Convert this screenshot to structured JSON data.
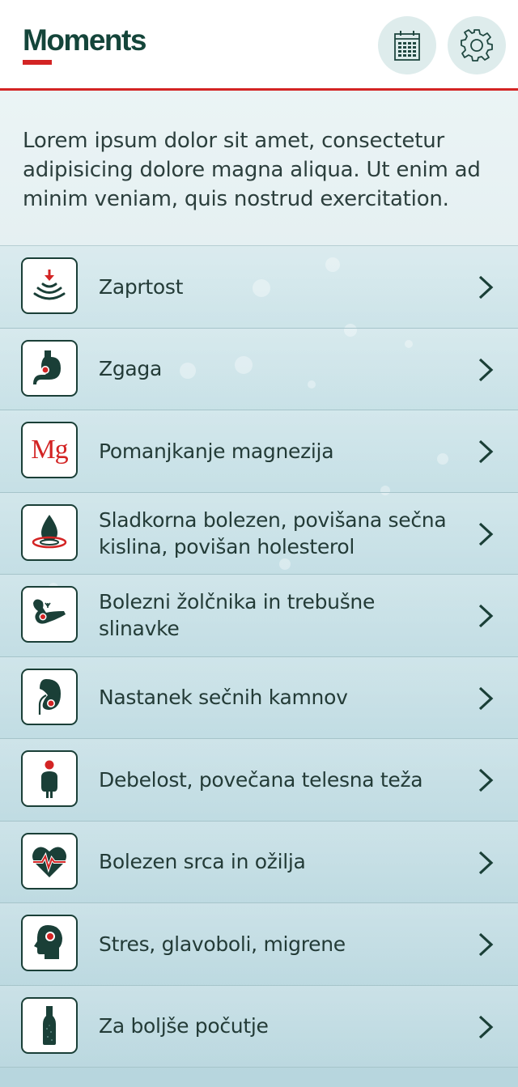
{
  "header": {
    "logo": "Moments",
    "calendar_icon": "calendar-icon",
    "settings_icon": "gear-icon"
  },
  "intro": {
    "text": "Lorem ipsum dolor sit amet, consectetur adipisicing  dolore magna aliqua. Ut enim ad minim veniam, quis nostrud exercitation."
  },
  "colors": {
    "accent": "#d32424",
    "brand": "#14453a",
    "background": "#c4dfe5"
  },
  "items": [
    {
      "label": "Zaprtost",
      "icon": "intestine-down-arrow-icon"
    },
    {
      "label": "Zgaga",
      "icon": "stomach-icon"
    },
    {
      "label": "Pomanjkanje magnezija",
      "icon": "magnesium-icon",
      "icon_text": "Mg"
    },
    {
      "label": "Sladkorna bolezen, povišana sečna kislina, povišan holesterol",
      "icon": "drop-icon"
    },
    {
      "label": "Bolezni žolčnika in trebušne slinavke",
      "icon": "pancreas-icon"
    },
    {
      "label": "Nastanek sečnih kamnov",
      "icon": "kidney-icon"
    },
    {
      "label": "Debelost, povečana telesna teža",
      "icon": "body-weight-icon"
    },
    {
      "label": "Bolezen srca in ožilja",
      "icon": "heart-icon"
    },
    {
      "label": "Stres, glavoboli, migrene",
      "icon": "head-icon"
    },
    {
      "label": "Za boljše počutje",
      "icon": "bottle-icon"
    }
  ]
}
